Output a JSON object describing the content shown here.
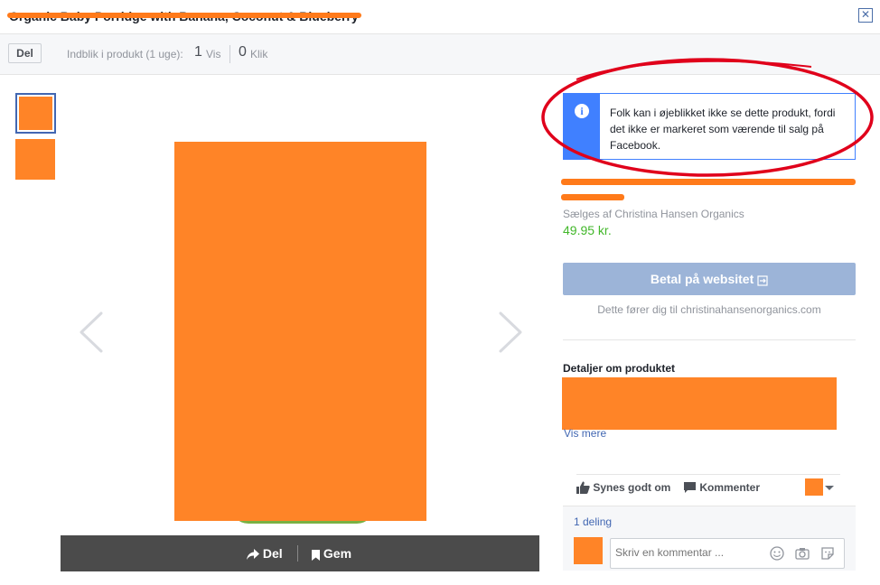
{
  "header": {
    "title": "Organic Baby Porridge with Banana, Coconut & Blueberry"
  },
  "toolbar": {
    "share_label": "Del",
    "insight_label": "Indblik i produkt (1 uge):",
    "views_count": "1",
    "views_label": "Vis",
    "clicks_count": "0",
    "clicks_label": "Klik"
  },
  "image_bar": {
    "share_label": "Del",
    "save_label": "Gem"
  },
  "notice": {
    "text": "Folk kan i øjeblikket ikke se dette produkt, fordi det ikke er markeret som værende til salg på Facebook."
  },
  "product": {
    "seller": "Sælges af Christina Hansen Organics",
    "price": "49.95 kr.",
    "pay_button": "Betal på websitet",
    "redirect_note": "Dette fører dig til christinahansenorganics.com",
    "details_heading": "Detaljer om produktet",
    "see_more": "Vis mere"
  },
  "actions": {
    "like": "Synes godt om",
    "comment": "Kommenter",
    "share_count": "1 deling",
    "comment_placeholder": "Skriv en kommentar ..."
  },
  "colors": {
    "accent": "#4267b2",
    "notice_blue": "#4080ff",
    "price_green": "#42b72a",
    "redaction": "#ff8427",
    "annotation_red": "#e0001b"
  }
}
